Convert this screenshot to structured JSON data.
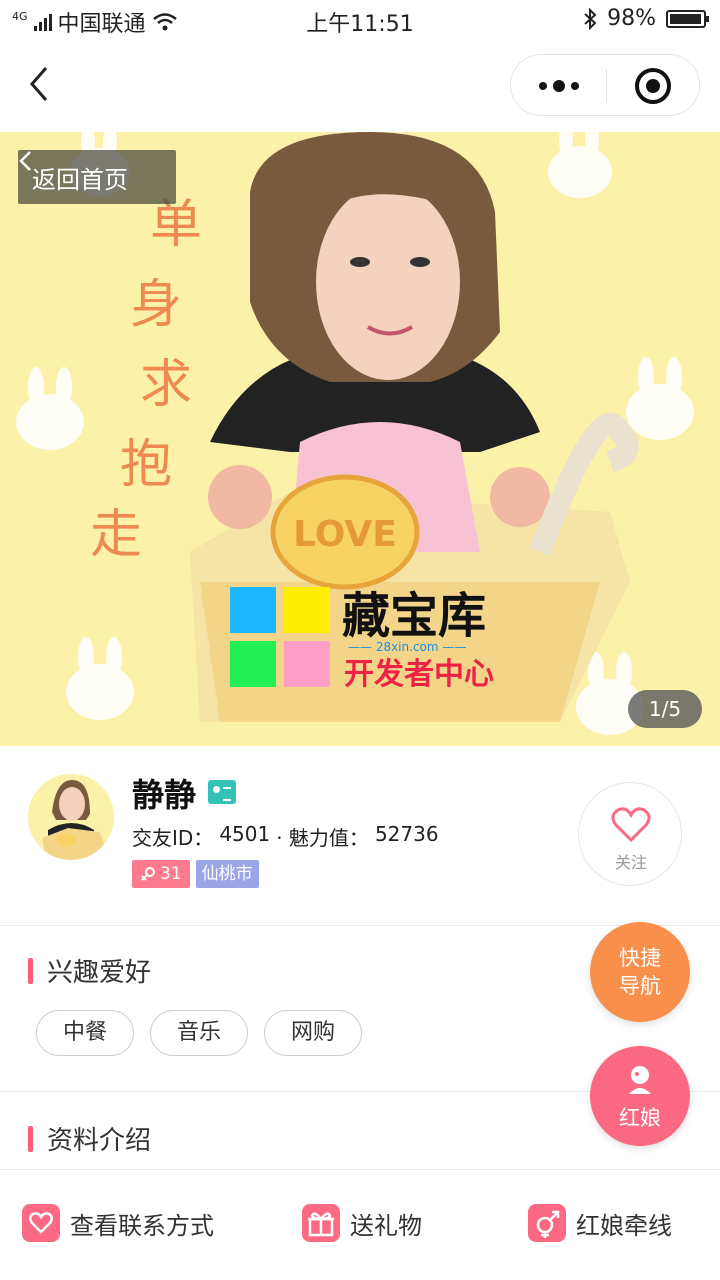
{
  "status_bar": {
    "network": "4G",
    "carrier": "中国联通",
    "time": "上午11:51",
    "battery": "98%",
    "battery_level": 0.98
  },
  "nav": {
    "back_icon": "back-chevron-icon",
    "menu_icon": "more-dots-icon",
    "close_icon": "target-icon"
  },
  "hero": {
    "back_home_label": "返回首页",
    "counter": "1/5",
    "handwriting": "单身求抱走",
    "box_text": "LOVE",
    "watermark_title": "藏宝库",
    "watermark_url": "—— 28xin.com ——",
    "watermark_sub": "开发者中心"
  },
  "profile": {
    "name": "静静",
    "id_label": "交友ID：",
    "id_value": "4501",
    "charm_label": "· 魅力值：",
    "charm_value": "52736",
    "age": "31",
    "city": "仙桃市",
    "follow_label": "关注"
  },
  "interests": {
    "title": "兴趣爱好",
    "items": [
      "中餐",
      "音乐",
      "网购"
    ]
  },
  "about": {
    "title": "资料介绍"
  },
  "floating": {
    "quick_nav": [
      "快捷",
      "导航"
    ],
    "matchmaker": "红娘"
  },
  "bottom_bar": {
    "contact": "查看联系方式",
    "gift": "送礼物",
    "matchmaking": "红娘牵线"
  },
  "colors": {
    "accent_pink": "#fb6a82",
    "accent_orange": "#f8904c",
    "hero_bg": "#fbf1a8"
  }
}
